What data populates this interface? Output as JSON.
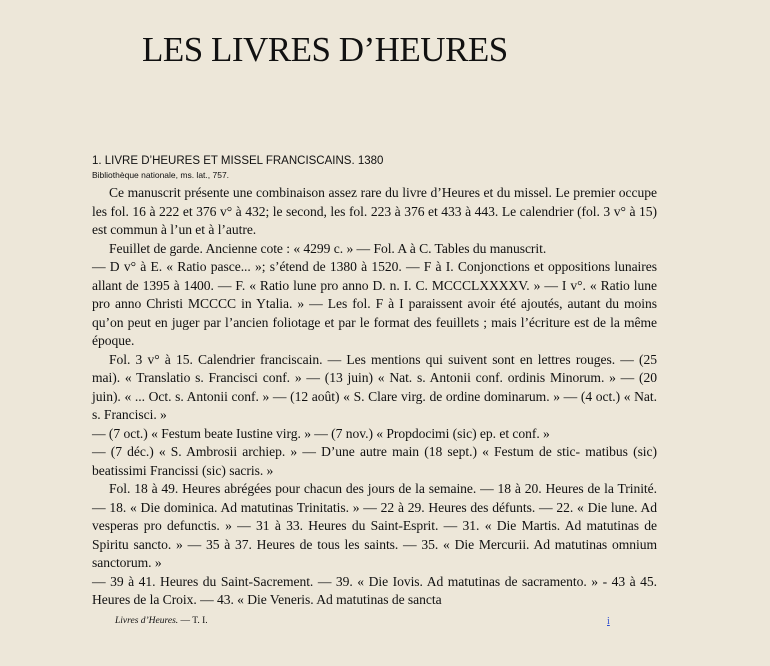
{
  "title": "LES LIVRES D’HEURES",
  "heading": "1. LIVRE D’HEURES ET MISSEL FRANCISCAINS. 1380",
  "subheading": "Bibliothèque nationale, ms. lat., 757.",
  "paragraphs": [
    "Ce manuscrit présente une combinaison assez rare du livre d’Heures et du missel. Le premier occupe les fol. 16 à 222 et 376 v° à 432; le second, les fol. 223 à 376 et 433 à 443. Le calendrier (fol. 3 v° à 15) est commun à l’un et à l’autre.",
    "Feuillet de garde. Ancienne cote : « 4299 c. » — Fol. A à C. Tables du manuscrit.",
    "—  D v° à E. « Ratio pasce... »; s’étend de 1380 à 1520. — F à I. Conjonctions et oppositions lunaires allant de 1395 à 1400. — F. « Ratio lune pro anno D. n. I. C. MCCCLXXXXV. » — I v°. « Ratio lune pro anno Christi MCCCC in Ytalia. » — Les fol. F à I paraissent avoir été ajoutés, autant du moins qu’on peut en juger par l’ancien foliotage et par le format des feuillets ; mais l’écriture est de la même époque.",
    "Fol. 3 v° à 15. Calendrier franciscain. — Les mentions qui suivent sont en lettres rouges. — (25 mai). « Translatio s. Francisci conf. » — (13 juin) « Nat. s. Antonii conf. ordinis Minorum. » — (20 juin). « ... Oct. s. Antonii conf. » — (12 août) « S. Clare virg. de ordine dominarum. » — (4 oct.) « Nat. s. Francisci. »",
    "—  (7 oct.) « Festum beate Iustine virg. » — (7 nov.) « Propdocimi (sic) ep. et conf. »",
    "—  (7 déc.) « S. Ambrosii archiep. » — D’une autre main (18 sept.) « Festum de stic- matibus (sic) beatissimi Francissi (sic) sacris. »",
    "Fol. 18 à 49. Heures abrégées pour chacun des jours de la semaine. — 18 à 20. Heures de la Trinité. — 18. « Die dominica. Ad matutinas Trinitatis. » — 22 à 29. Heures des défunts. — 22. « Die lune. Ad vesperas pro defunctis. » — 31 à 33. Heures du Saint-Esprit. — 31. « Die Martis. Ad matutinas de Spiritu sancto. » — 35 à 37. Heures de tous les saints. — 35. « Die Mercurii. Ad matutinas omnium sanctorum. »",
    "—  39 à 41. Heures du Saint-Sacrement. — 39. « Die Iovis. Ad matutinas de sacramento. » - 43 à 45. Heures de la Croix. — 43. « Die Veneris. Ad matutinas de sancta"
  ],
  "footer": {
    "left_italic": "Livres d’Heures.",
    "left_rest": " — T. I.",
    "right": "i"
  }
}
